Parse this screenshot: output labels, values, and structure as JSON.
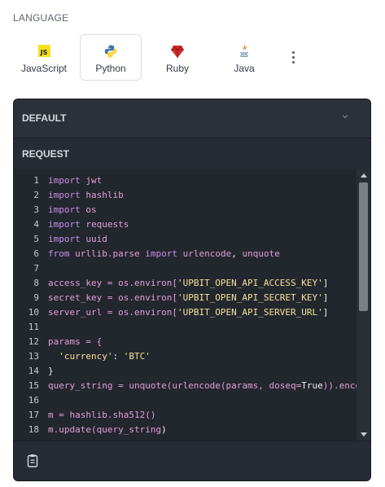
{
  "language_title": "LANGUAGE",
  "languages": [
    {
      "label": "JavaScript",
      "icon": "javascript-icon",
      "icon_text": "JS"
    },
    {
      "label": "Python",
      "icon": "python-icon",
      "active": true
    },
    {
      "label": "Ruby",
      "icon": "ruby-icon"
    },
    {
      "label": "Java",
      "icon": "java-icon"
    }
  ],
  "more_icon": "vertical-ellipsis-icon",
  "panel": {
    "default_label": "DEFAULT",
    "request_label": "REQUEST",
    "copy_icon": "clipboard-icon",
    "colors": {
      "panel_bg": "#272b33",
      "code_bg": "#22262d",
      "keyword": "#c792ea",
      "string": "#f4e19a"
    }
  },
  "code_lines": [
    {
      "n": "1",
      "tokens": [
        [
          "kw",
          "import"
        ],
        [
          "pl",
          " "
        ],
        [
          "op",
          "jwt"
        ]
      ]
    },
    {
      "n": "2",
      "tokens": [
        [
          "kw",
          "import"
        ],
        [
          "pl",
          " "
        ],
        [
          "op",
          "hashlib"
        ]
      ]
    },
    {
      "n": "3",
      "tokens": [
        [
          "kw",
          "import"
        ],
        [
          "pl",
          " "
        ],
        [
          "op",
          "os"
        ]
      ]
    },
    {
      "n": "4",
      "tokens": [
        [
          "kw",
          "import"
        ],
        [
          "pl",
          " "
        ],
        [
          "op",
          "requests"
        ]
      ]
    },
    {
      "n": "5",
      "tokens": [
        [
          "kw",
          "import"
        ],
        [
          "pl",
          " "
        ],
        [
          "op",
          "uuid"
        ]
      ]
    },
    {
      "n": "6",
      "tokens": [
        [
          "kw",
          "from"
        ],
        [
          "pl",
          " "
        ],
        [
          "op",
          "urllib.parse"
        ],
        [
          "pl",
          " "
        ],
        [
          "kw",
          "import"
        ],
        [
          "pl",
          " "
        ],
        [
          "op",
          "urlencode"
        ],
        [
          "pl",
          ", "
        ],
        [
          "op",
          "unquote"
        ]
      ]
    },
    {
      "n": "7",
      "tokens": []
    },
    {
      "n": "8",
      "tokens": [
        [
          "op",
          "access_key = os.environ["
        ],
        [
          "str",
          "'UPBIT_OPEN_API_ACCESS_KEY'"
        ],
        [
          "pl",
          "]"
        ]
      ]
    },
    {
      "n": "9",
      "tokens": [
        [
          "op",
          "secret_key = os.environ["
        ],
        [
          "str",
          "'UPBIT_OPEN_API_SECRET_KEY'"
        ],
        [
          "pl",
          "]"
        ]
      ]
    },
    {
      "n": "10",
      "tokens": [
        [
          "op",
          "server_url = os.environ["
        ],
        [
          "str",
          "'UPBIT_OPEN_API_SERVER_URL'"
        ],
        [
          "pl",
          "]"
        ]
      ]
    },
    {
      "n": "11",
      "tokens": []
    },
    {
      "n": "12",
      "tokens": [
        [
          "op",
          "params = {"
        ]
      ]
    },
    {
      "n": "13",
      "tokens": [
        [
          "pl",
          "  "
        ],
        [
          "str",
          "'currency'"
        ],
        [
          "pl",
          ": "
        ],
        [
          "str",
          "'BTC'"
        ]
      ]
    },
    {
      "n": "14",
      "tokens": [
        [
          "pl",
          "}"
        ]
      ]
    },
    {
      "n": "15",
      "tokens": [
        [
          "op",
          "query_string = unquote(urlencode(params, doseq="
        ],
        [
          "pl",
          "True"
        ],
        [
          "op",
          ")).enco"
        ]
      ]
    },
    {
      "n": "16",
      "tokens": []
    },
    {
      "n": "17",
      "tokens": [
        [
          "op",
          "m = hashlib.sha512()"
        ]
      ]
    },
    {
      "n": "18",
      "tokens": [
        [
          "op",
          "m.update(query_string"
        ],
        [
          "pl",
          ")"
        ]
      ]
    }
  ]
}
